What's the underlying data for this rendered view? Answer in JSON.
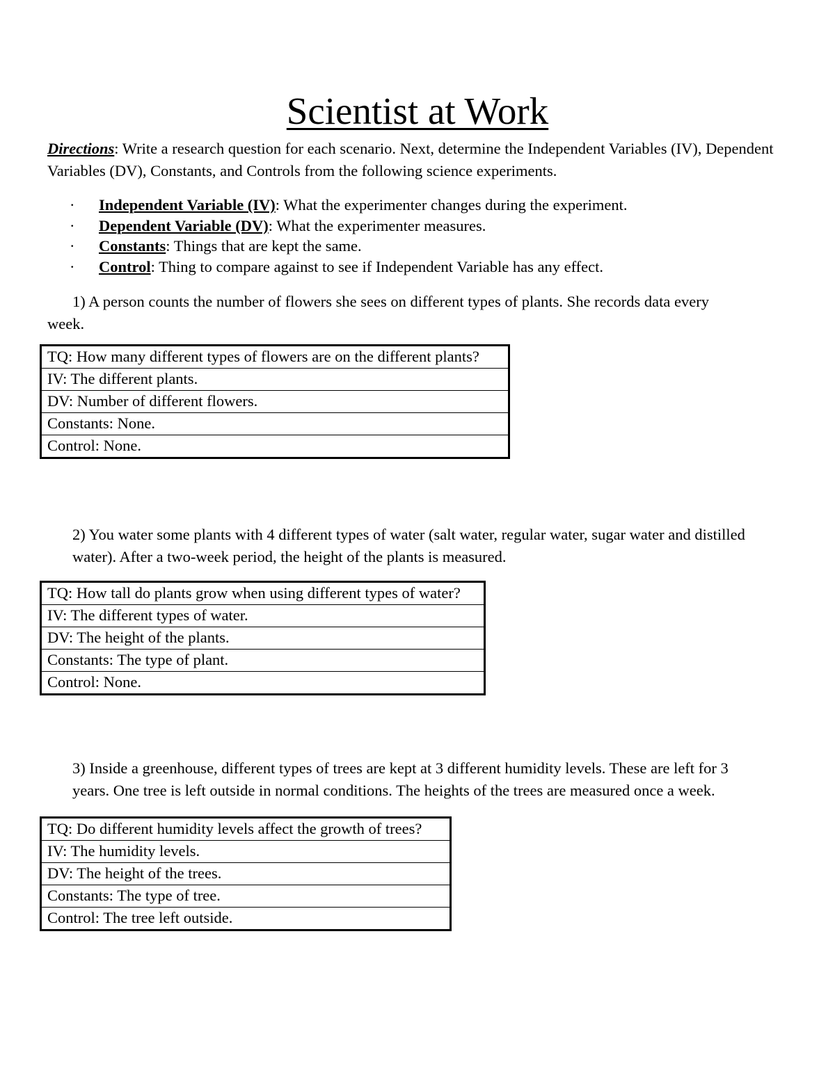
{
  "document": {
    "title": "Scientist at Work",
    "directions": {
      "lead_label": "Directions",
      "line1_rest": ": Write a research question for each scenario.  Next, determine the Independent Variables (IV),",
      "line2": "Dependent Variables (DV), Constants, and Controls from the following science experiments."
    },
    "definitions": {
      "bullet_glyph": "·",
      "items": [
        {
          "term": "Independent Variable (IV)",
          "definition": ": What the experimenter changes during the experiment."
        },
        {
          "term": "Dependent Variable (DV)",
          "definition": ":  What the experimenter measures."
        },
        {
          "term": "Constants",
          "definition": ":  Things that are kept the same."
        },
        {
          "term": "Control",
          "definition": ":  Thing to compare against to see if Independent Variable has any effect."
        }
      ]
    },
    "scenarios": [
      {
        "number": "1)",
        "line1": "1)   A person counts the number of flowers she sees on different types of plants.  She records data every",
        "line2": "week.",
        "table_rows": [
          "TQ: How many different types of flowers are on the different plants?",
          "IV: The different plants.",
          "DV: Number of different flowers.",
          "Constants: None.",
          "Control: None."
        ]
      },
      {
        "number": "2)",
        "line1": "2)   You water some plants with 4 different types of water (salt water, regular water, sugar water and distilled",
        "line2": "water). After a two-week period, the height of the plants is measured.",
        "table_rows": [
          "TQ: How tall do plants grow when using different types of water?",
          "IV: The different types of water.",
          "DV: The height of the plants.",
          "Constants: The type of plant.",
          "Control: None."
        ]
      },
      {
        "number": "3)",
        "line1": "3)   Inside a greenhouse, different types of trees are kept at 3 different humidity levels.  These are left for 3",
        "line2": "years. One tree is left outside in normal conditions.  The heights of the trees are measured once a week.",
        "table_rows": [
          "TQ: Do different humidity levels affect the growth of trees?",
          "IV: The humidity levels.",
          "DV: The height of the trees.",
          "Constants: The type of tree.",
          "Control: The tree left outside."
        ]
      }
    ]
  }
}
